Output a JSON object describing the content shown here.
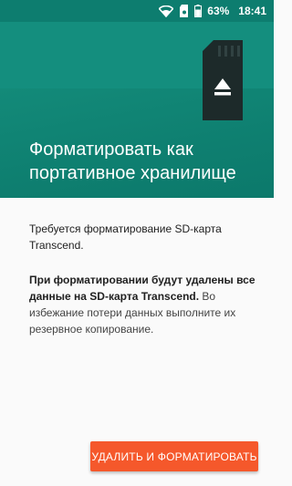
{
  "status_bar": {
    "battery_percent": "63%",
    "time": "18:41",
    "icons": [
      "wifi-icon",
      "sd-card-status-icon",
      "battery-icon"
    ]
  },
  "header": {
    "title": "Форматировать как портативное хранилище",
    "icon": "sd-card-eject-icon",
    "colors": {
      "background": "#0f8676",
      "title": "#ffffff"
    }
  },
  "body": {
    "para1": "Требуется форматирование SD-карта Transcend.",
    "para2_bold": "При форматировании будут удалены все данные на SD-карта Transcend.",
    "para2_rest": " Во избежание потери данных выполните их резервное копирование."
  },
  "action": {
    "label": "УДАЛИТЬ И ФОРМАТИРОВАТЬ",
    "color": "#f5582b"
  }
}
